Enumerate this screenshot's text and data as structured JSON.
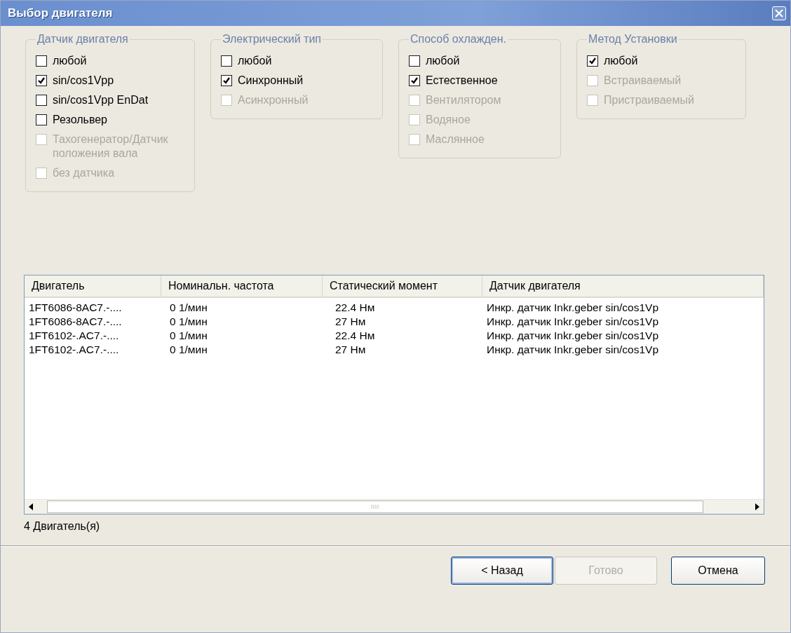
{
  "window": {
    "title": "Выбор двигателя"
  },
  "groups": [
    {
      "title": "Датчик двигателя",
      "options": [
        {
          "label": "любой",
          "checked": false,
          "disabled": false
        },
        {
          "label": "sin/cos1Vpp",
          "checked": true,
          "disabled": false
        },
        {
          "label": "sin/cos1Vpp EnDat",
          "checked": false,
          "disabled": false
        },
        {
          "label": "Резольвер",
          "checked": false,
          "disabled": false
        },
        {
          "label": "Тахогенератор/Датчик положения вала",
          "checked": false,
          "disabled": true
        },
        {
          "label": "без датчика",
          "checked": false,
          "disabled": true
        }
      ]
    },
    {
      "title": "Электрический тип",
      "options": [
        {
          "label": "любой",
          "checked": false,
          "disabled": false
        },
        {
          "label": "Синхронный",
          "checked": true,
          "disabled": false
        },
        {
          "label": "Асинхронный",
          "checked": false,
          "disabled": true
        }
      ]
    },
    {
      "title": "Способ охлажден.",
      "options": [
        {
          "label": "любой",
          "checked": false,
          "disabled": false
        },
        {
          "label": "Естественное",
          "checked": true,
          "disabled": false
        },
        {
          "label": "Вентилятором",
          "checked": false,
          "disabled": true
        },
        {
          "label": "Водяное",
          "checked": false,
          "disabled": true
        },
        {
          "label": "Маслянное",
          "checked": false,
          "disabled": true
        }
      ]
    },
    {
      "title": "Метод Установки",
      "options": [
        {
          "label": "любой",
          "checked": true,
          "disabled": false
        },
        {
          "label": "Встраиваемый",
          "checked": false,
          "disabled": true
        },
        {
          "label": "Пристраиваемый",
          "checked": false,
          "disabled": true
        }
      ]
    }
  ],
  "table": {
    "columns": [
      "Двигатель",
      "Номинальн. частота",
      "Статический момент",
      "Датчик двигателя"
    ],
    "rows": [
      [
        "1FT6086-8AC7.-....",
        "0 1/мин",
        "22.4 Нм",
        "Инкр. датчик Inkr.geber sin/cos1Vp"
      ],
      [
        "1FT6086-8AC7.-....",
        "0 1/мин",
        "27 Нм",
        "Инкр. датчик Inkr.geber sin/cos1Vp"
      ],
      [
        "1FT6102-.AC7.-....",
        "0 1/мин",
        "22.4 Нм",
        "Инкр. датчик Inkr.geber sin/cos1Vp"
      ],
      [
        "1FT6102-.AC7.-....",
        "0 1/мин",
        "27 Нм",
        "Инкр. датчик Inkr.geber sin/cos1Vp"
      ]
    ]
  },
  "status": "4 Двигатель(я)",
  "buttons": [
    {
      "label": "< Назад",
      "disabled": false,
      "focused": true
    },
    {
      "label": "Готово",
      "disabled": true,
      "focused": false
    },
    {
      "label": "Отмена",
      "disabled": false,
      "focused": false
    }
  ]
}
